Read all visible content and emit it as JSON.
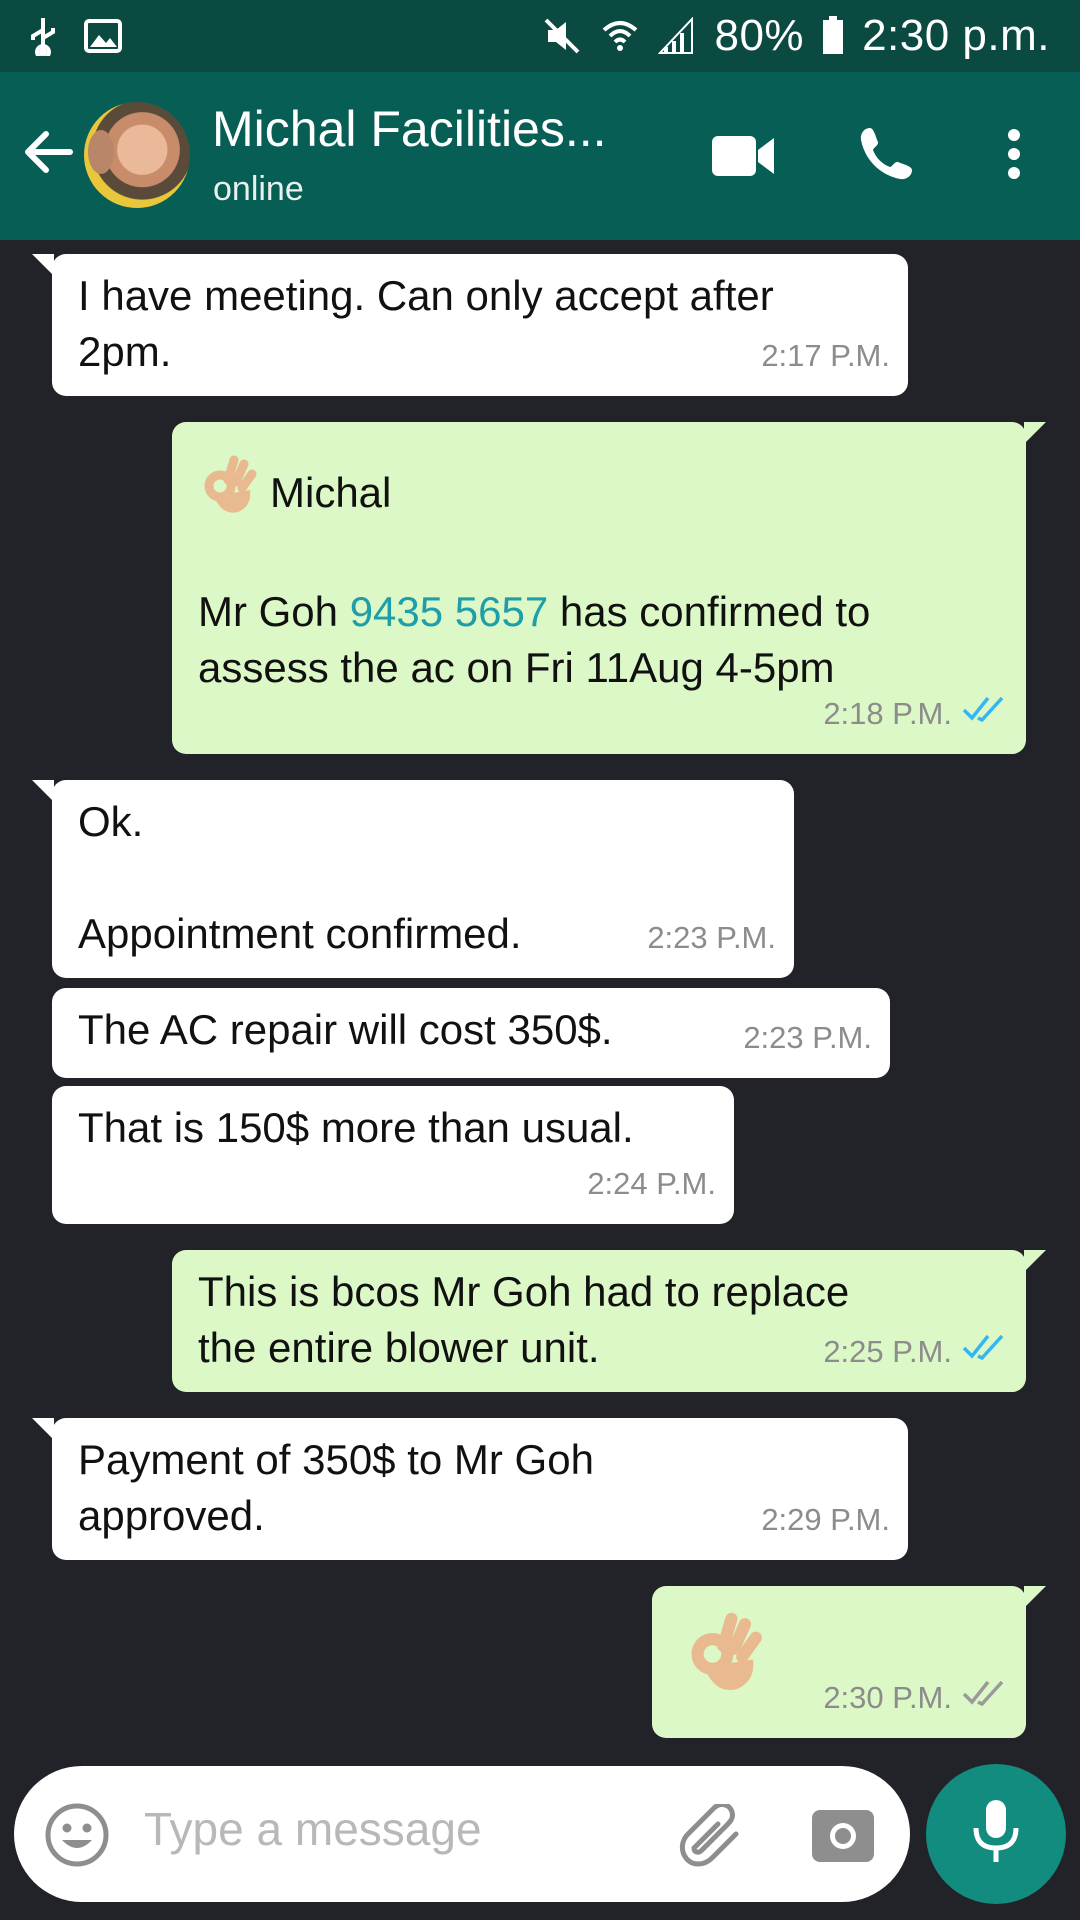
{
  "status_bar": {
    "battery": "80%",
    "time": "2:30 p.m.",
    "icons": [
      "usb-icon",
      "image-icon",
      "mute-icon",
      "wifi-icon",
      "signal-icon",
      "battery-icon"
    ]
  },
  "header": {
    "contact_name": "Michal Facilities...",
    "status": "online",
    "icons": [
      "back-arrow-icon",
      "video-call-icon",
      "phone-icon",
      "more-vert-icon"
    ]
  },
  "messages": [
    {
      "dir": "in",
      "text": "I have meeting. Can only accept after\n2pm.",
      "time": "2:17 P.M."
    },
    {
      "dir": "out",
      "emoji": "ok-hand-icon",
      "greeting": "Michal",
      "pre": "Mr Goh ",
      "link": "9435 5657",
      "post": " has confirmed to\nassess the ac on Fri 11Aug 4-5pm",
      "time": "2:18 P.M.",
      "ticks": "read"
    },
    {
      "dir": "in",
      "text": "Ok.\n\nAppointment confirmed.",
      "time": "2:23 P.M."
    },
    {
      "dir": "in",
      "text": "The AC repair will cost 350$.",
      "time": "2:23 P.M."
    },
    {
      "dir": "in",
      "text": "That is 150$ more than usual.",
      "time": "2:24 P.M."
    },
    {
      "dir": "out",
      "text": "This is bcos Mr Goh had to replace\nthe entire blower unit.",
      "time": "2:25 P.M.",
      "ticks": "read"
    },
    {
      "dir": "in",
      "text": "Payment of 350$ to Mr Goh\napproved.",
      "time": "2:29 P.M."
    },
    {
      "dir": "out",
      "emoji": "ok-hand-icon",
      "time": "2:30 P.M.",
      "ticks": "delivered"
    }
  ],
  "input": {
    "placeholder": "Type a message",
    "icons": [
      "emoji-icon",
      "attach-icon",
      "camera-icon",
      "mic-icon"
    ]
  },
  "colors": {
    "header": "#075e54",
    "status_bar": "#0a4a40",
    "outgoing_bubble": "#dcf8c6",
    "incoming_bubble": "#ffffff",
    "link": "#1d9ea8",
    "read_ticks": "#34b7f1",
    "mic_button": "#128c7e"
  }
}
